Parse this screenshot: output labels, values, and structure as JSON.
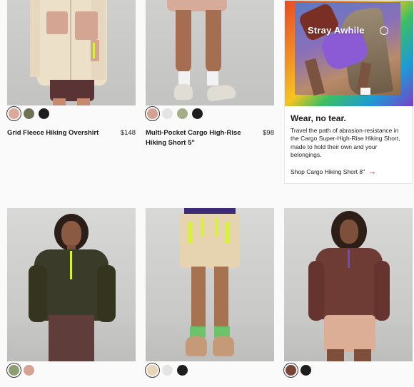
{
  "products": [
    {
      "name": "Grid Fleece Hiking Overshirt",
      "price": "$148",
      "swatches": [
        "#d9a99a",
        "#6f7252",
        "#1d1d1d"
      ],
      "selected": 0
    },
    {
      "name": "Multi-Pocket Cargo High-Rise Hiking Short 5\"",
      "price": "$98",
      "swatches": [
        "#d3a293",
        "#e4e4e4",
        "#a3ad86",
        "#1d1d1d"
      ],
      "selected": 0
    },
    {
      "name": "",
      "price": "",
      "swatches": [
        "#8d9d74",
        "#d8a293"
      ],
      "selected": 0
    },
    {
      "name": "",
      "price": "",
      "swatches": [
        "#ead4b6",
        "#e4e4e4",
        "#1d1d1d"
      ],
      "selected": 0
    },
    {
      "name": "",
      "price": "",
      "swatches": [
        "#7a4338",
        "#1d1d1d"
      ],
      "selected": 0
    }
  ],
  "promo": {
    "image_title": "Stray Awhile",
    "heading": "Wear, no tear.",
    "body": "Travel the path of abrasion-resistance in the Cargo Super-High-Rise Hiking Short, made to hold their own and your belongings.",
    "link_label": "Shop Cargo Hiking Short 8\"",
    "link_icon": "arrow-right-icon",
    "accent": "#d31f2a"
  }
}
